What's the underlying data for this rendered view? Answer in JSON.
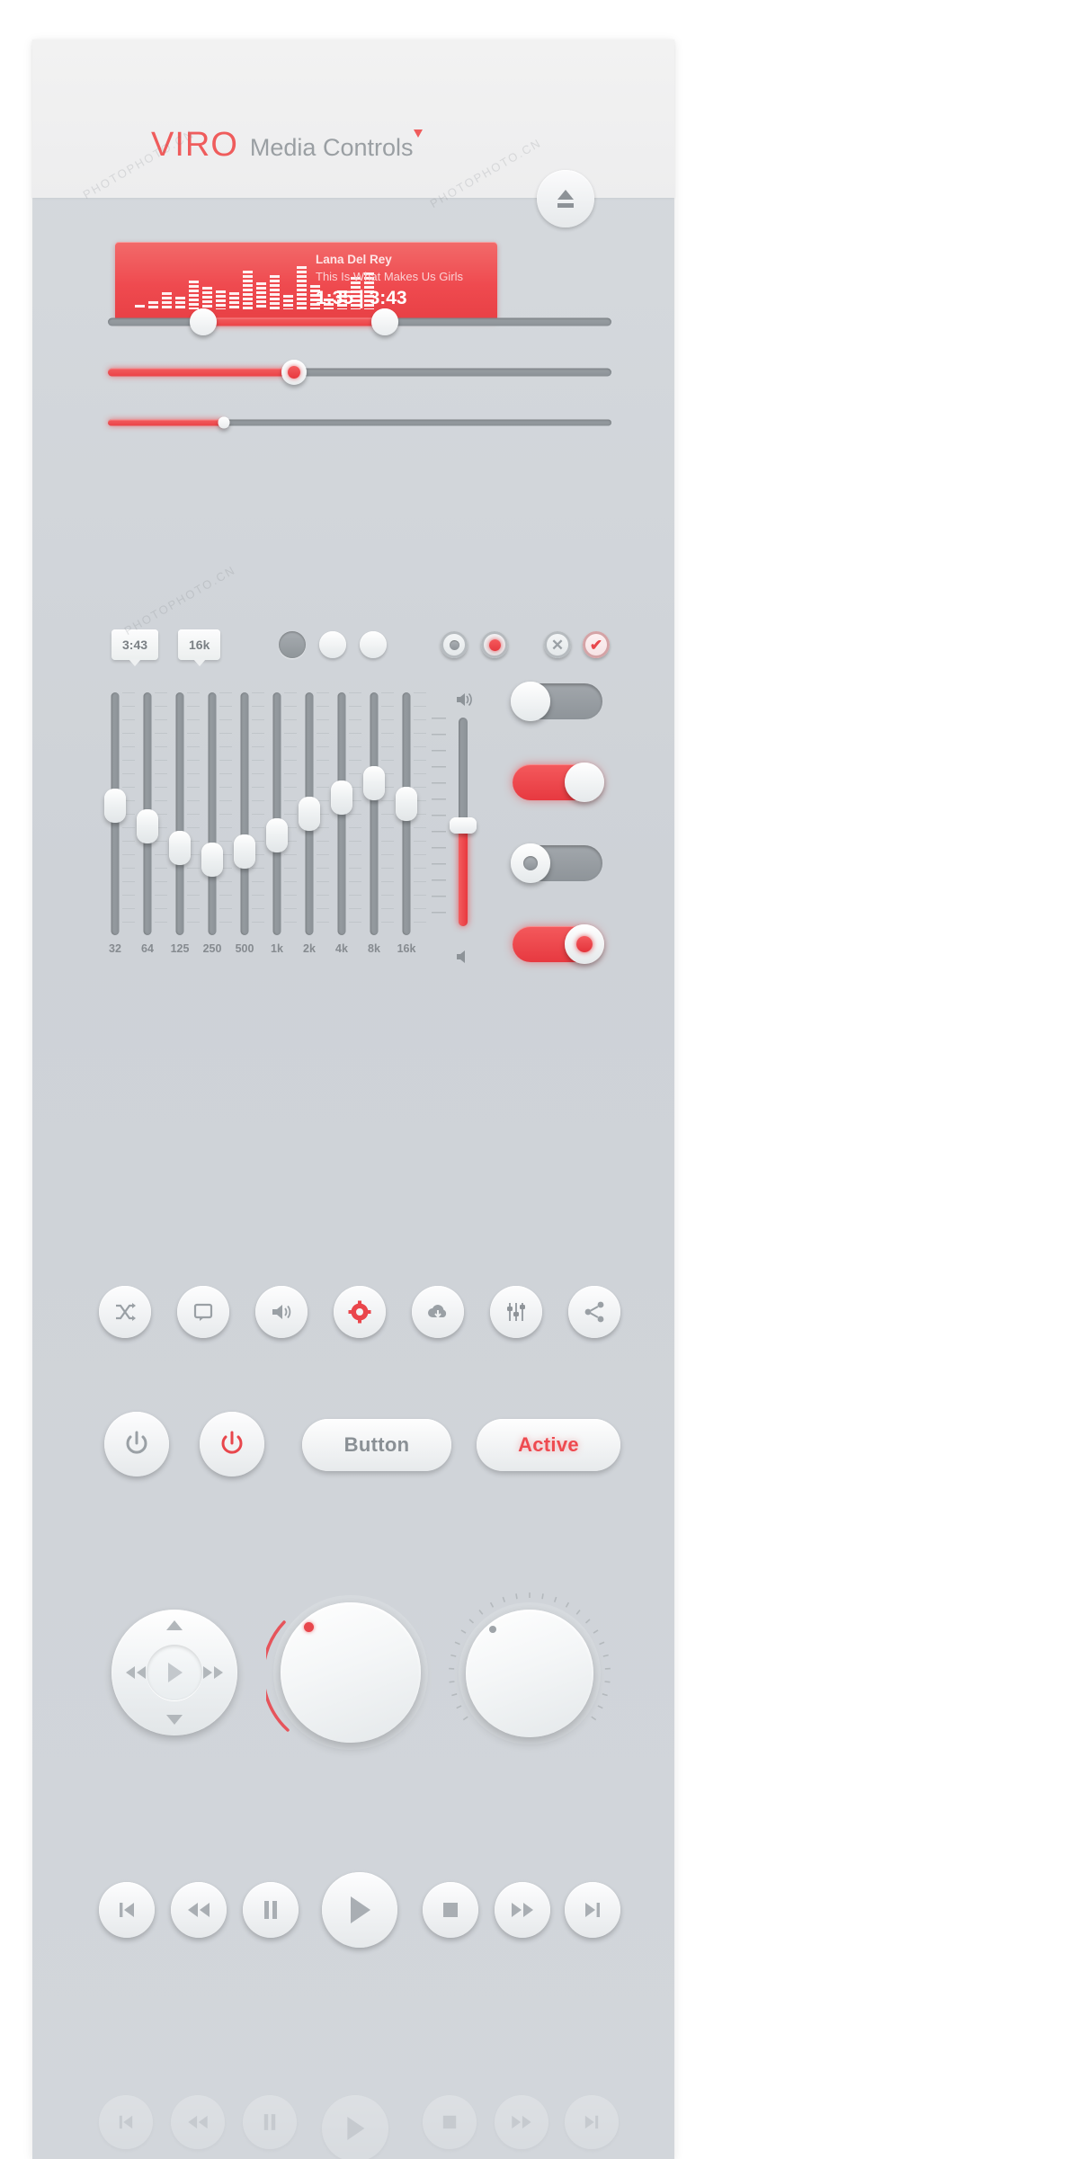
{
  "header": {
    "brand": "VIRO",
    "subtitle": "Media Controls"
  },
  "now_playing": {
    "artist": "Lana Del Rey",
    "title": "This Is What Makes Us Girls",
    "time": "1:35 | 3:43",
    "elapsed": "1:35",
    "duration": "3:43",
    "accent_color": "#ee474d",
    "equalizer_levels": [
      8,
      14,
      30,
      22,
      52,
      40,
      34,
      30,
      70,
      48,
      62,
      26,
      78,
      44,
      20,
      34,
      58,
      66
    ]
  },
  "eject_button": {
    "icon": "eject-icon"
  },
  "h_sliders": [
    {
      "name": "range-slider",
      "fill_start_pct": 19,
      "fill_end_pct": 55,
      "style": "range"
    },
    {
      "name": "value-slider",
      "fill_pct": 37,
      "style": "single"
    },
    {
      "name": "thin-slider",
      "fill_pct": 23,
      "style": "thin"
    }
  ],
  "tooltips": [
    {
      "label": "3:43"
    },
    {
      "label": "16k"
    }
  ],
  "circle_buttons": [
    {
      "name": "circle-filled",
      "state": "selected"
    },
    {
      "name": "circle-empty-a",
      "state": "normal"
    },
    {
      "name": "circle-empty-b",
      "state": "normal"
    }
  ],
  "radio_buttons": [
    {
      "name": "radio-gray",
      "state": "off"
    },
    {
      "name": "radio-red",
      "state": "on"
    }
  ],
  "action_buttons": [
    {
      "name": "cancel-button",
      "glyph": "✕"
    },
    {
      "name": "confirm-button",
      "glyph": "✔"
    }
  ],
  "equalizer": {
    "bands": [
      {
        "label": "32",
        "value": 62
      },
      {
        "label": "64",
        "value": 52
      },
      {
        "label": "125",
        "value": 42
      },
      {
        "label": "250",
        "value": 36
      },
      {
        "label": "500",
        "value": 40
      },
      {
        "label": "1k",
        "value": 48
      },
      {
        "label": "2k",
        "value": 58
      },
      {
        "label": "4k",
        "value": 66
      },
      {
        "label": "8k",
        "value": 73
      },
      {
        "label": "16k",
        "value": 63
      }
    ]
  },
  "volume": {
    "name": "volume-slider",
    "value_pct": 48,
    "icon_top": "volume-high-icon",
    "icon_bottom": "volume-mute-icon"
  },
  "toggles": [
    {
      "name": "toggle-off-plain",
      "state": "off",
      "knob": "plain"
    },
    {
      "name": "toggle-on-plain",
      "state": "on",
      "knob": "plain"
    },
    {
      "name": "toggle-off-dot",
      "state": "off",
      "knob": "dot-gray"
    },
    {
      "name": "toggle-on-dot",
      "state": "on",
      "knob": "dot-red"
    }
  ],
  "icon_buttons": [
    {
      "name": "shuffle-icon",
      "active": false
    },
    {
      "name": "repeat-icon",
      "active": false
    },
    {
      "name": "volume-icon",
      "active": false
    },
    {
      "name": "gear-icon",
      "active": true
    },
    {
      "name": "cloud-download-icon",
      "active": false
    },
    {
      "name": "equalizer-icon",
      "active": false
    },
    {
      "name": "share-icon",
      "active": false
    }
  ],
  "power_buttons": [
    {
      "name": "power-button-off",
      "active": false
    },
    {
      "name": "power-button-on",
      "active": true
    }
  ],
  "labeled_buttons": [
    {
      "name": "default-button",
      "label": "Button",
      "state": "normal"
    },
    {
      "name": "active-button",
      "label": "Active",
      "state": "active"
    }
  ],
  "dpad": {
    "name": "directional-pad",
    "up": "chevron-up-icon",
    "down": "chevron-down-icon",
    "left": "rewind-icon",
    "right": "fast-forward-icon",
    "center": "play-icon"
  },
  "knobs": [
    {
      "name": "volume-knob-red",
      "indicator_color": "#e8464c",
      "arc": true,
      "ticks": false
    },
    {
      "name": "tone-knob-gray",
      "indicator_color": "#9fa4a9",
      "arc": false,
      "ticks": true
    }
  ],
  "transport": [
    {
      "name": "previous-track-button",
      "icon": "skip-back-icon"
    },
    {
      "name": "rewind-button",
      "icon": "rewind-icon"
    },
    {
      "name": "pause-button",
      "icon": "pause-icon"
    },
    {
      "name": "play-button",
      "icon": "play-icon"
    },
    {
      "name": "stop-button",
      "icon": "stop-icon"
    },
    {
      "name": "fast-forward-button",
      "icon": "fast-forward-icon"
    },
    {
      "name": "next-track-button",
      "icon": "skip-forward-icon"
    }
  ],
  "watermarks": [
    "PHOTOPHOTO.CN",
    "PHOTOPHOTO.CN",
    "PHOTOPHOTO.CN"
  ]
}
